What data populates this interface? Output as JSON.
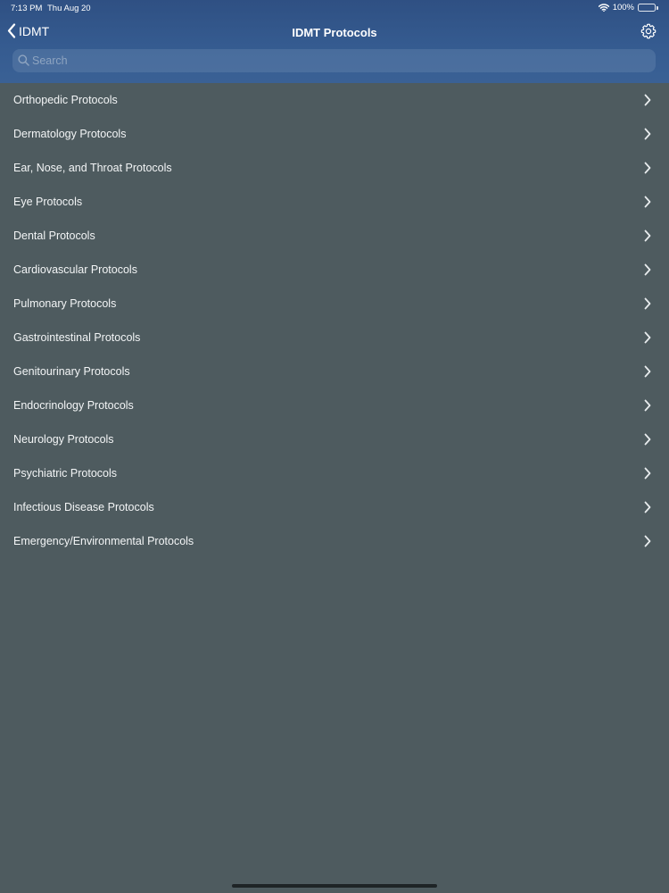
{
  "status_bar": {
    "time": "7:13 PM",
    "date": "Thu Aug 20",
    "battery": "100%"
  },
  "nav": {
    "back_label": "IDMT",
    "title": "IDMT Protocols"
  },
  "search": {
    "placeholder": "Search",
    "value": ""
  },
  "protocols": [
    "Orthopedic Protocols",
    "Dermatology Protocols",
    "Ear, Nose, and Throat Protocols",
    "Eye Protocols",
    "Dental Protocols",
    "Cardiovascular Protocols",
    "Pulmonary Protocols",
    "Gastrointestinal Protocols",
    "Genitourinary Protocols",
    "Endocrinology Protocols",
    "Neurology Protocols",
    "Psychiatric Protocols",
    "Infectious Disease Protocols",
    "Emergency/Environmental Protocols"
  ],
  "colors": {
    "header": "#355b90",
    "background": "#4e5b5f",
    "text": "#ffffff"
  },
  "icons": {
    "back": "chevron-left-icon",
    "settings": "gear-icon",
    "search": "search-icon",
    "row": "chevron-right-icon",
    "wifi": "wifi-icon",
    "battery": "battery-icon"
  }
}
